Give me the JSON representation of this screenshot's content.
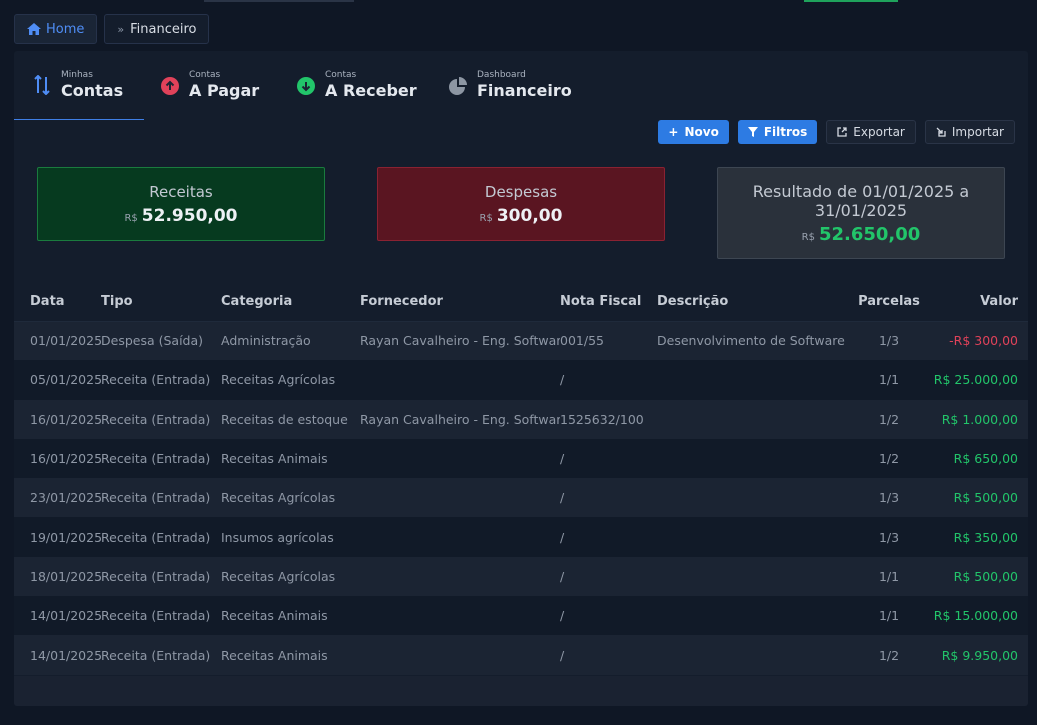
{
  "breadcrumb": {
    "home": "Home",
    "current": "Financeiro"
  },
  "tabs": [
    {
      "small": "Minhas",
      "big": "Contas",
      "icon": "sort-arrows-icon",
      "color": "#4f8df5"
    },
    {
      "small": "Contas",
      "big": "A Pagar",
      "icon": "arrow-up-circle-icon",
      "color": "#e0425a"
    },
    {
      "small": "Contas",
      "big": "A Receber",
      "icon": "arrow-down-circle-icon",
      "color": "#22c56a"
    },
    {
      "small": "Dashboard",
      "big": "Financeiro",
      "icon": "pie-chart-icon",
      "color": "#9aa3b0"
    }
  ],
  "actions": {
    "novo": "Novo",
    "filtros": "Filtros",
    "exportar": "Exportar",
    "importar": "Importar"
  },
  "cards": {
    "receitas": {
      "title": "Receitas",
      "currency": "R$",
      "value": "52.950,00"
    },
    "despesas": {
      "title": "Despesas",
      "currency": "R$",
      "value": "300,00"
    },
    "resultado": {
      "title": "Resultado de 01/01/2025 a 31/01/2025",
      "currency": "R$",
      "value": "52.650,00"
    }
  },
  "table": {
    "headers": [
      "Data",
      "Tipo",
      "Categoria",
      "Fornecedor",
      "Nota Fiscal",
      "Descrição",
      "Parcelas",
      "Valor"
    ],
    "rows": [
      [
        "01/01/2025",
        "Despesa (Saída)",
        "Administração",
        "Rayan Cavalheiro - Eng. Software",
        "001/55",
        "Desenvolvimento de Software",
        "1/3",
        "-R$ 300,00"
      ],
      [
        "05/01/2025",
        "Receita (Entrada)",
        "Receitas Agrícolas",
        "",
        "/",
        "",
        "1/1",
        "R$ 25.000,00"
      ],
      [
        "16/01/2025",
        "Receita (Entrada)",
        "Receitas de estoque",
        "Rayan Cavalheiro - Eng. Software",
        "1525632/100",
        "",
        "1/2",
        "R$ 1.000,00"
      ],
      [
        "16/01/2025",
        "Receita (Entrada)",
        "Receitas Animais",
        "",
        "/",
        "",
        "1/2",
        "R$ 650,00"
      ],
      [
        "23/01/2025",
        "Receita (Entrada)",
        "Receitas Agrícolas",
        "",
        "/",
        "",
        "1/3",
        "R$ 500,00"
      ],
      [
        "19/01/2025",
        "Receita (Entrada)",
        "Insumos agrícolas",
        "",
        "/",
        "",
        "1/3",
        "R$ 350,00"
      ],
      [
        "18/01/2025",
        "Receita (Entrada)",
        "Receitas Agrícolas",
        "",
        "/",
        "",
        "1/1",
        "R$ 500,00"
      ],
      [
        "14/01/2025",
        "Receita (Entrada)",
        "Receitas Animais",
        "",
        "/",
        "",
        "1/1",
        "R$ 15.000,00"
      ],
      [
        "14/01/2025",
        "Receita (Entrada)",
        "Receitas Animais",
        "",
        "/",
        "",
        "1/2",
        "R$ 9.950,00"
      ]
    ]
  },
  "colors": {
    "accent": "#2d7be3",
    "positive": "#22c56a",
    "negative": "#e0425a"
  }
}
